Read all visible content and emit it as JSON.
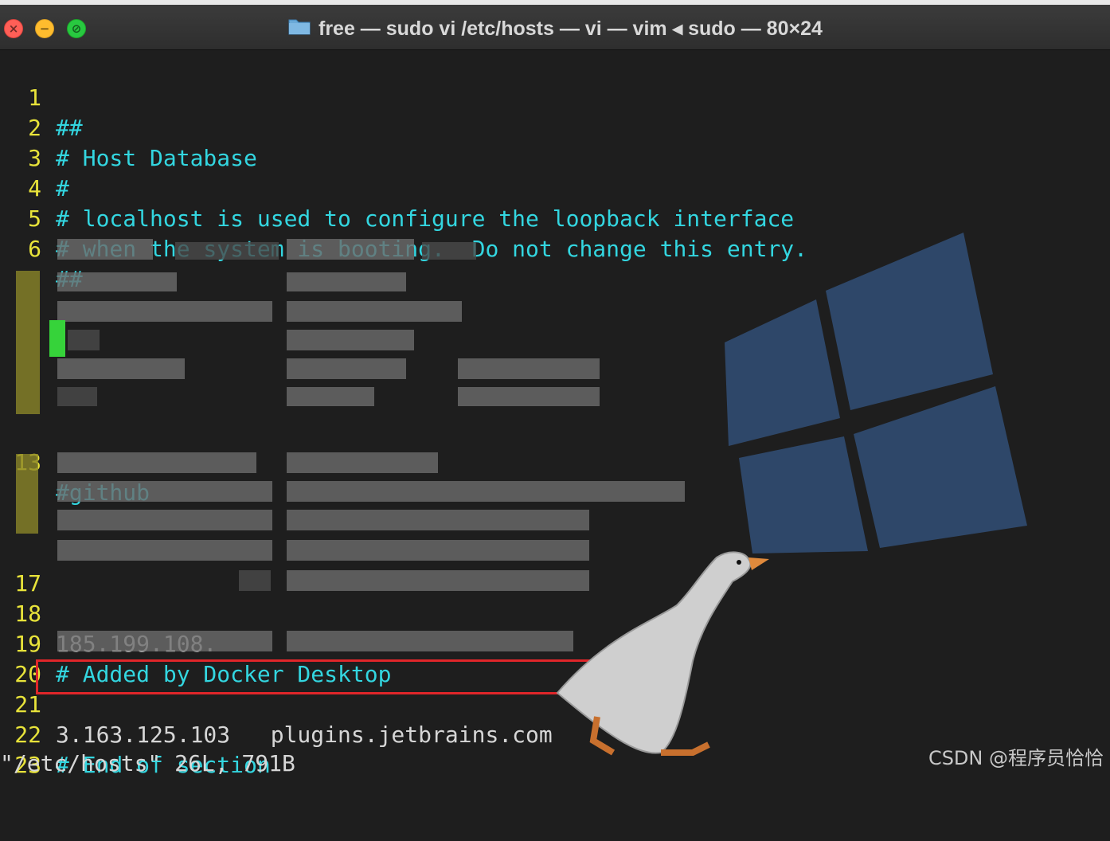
{
  "window": {
    "title": "free — sudo vi /etc/hosts — vi — vim ◂ sudo — 80×24",
    "controls": {
      "close_glyph": "×",
      "minimize_glyph": "−",
      "zoom_glyph": "⊘"
    }
  },
  "editor": {
    "lines": [
      {
        "num": "1",
        "text": "##",
        "color": "cyan"
      },
      {
        "num": "2",
        "text": "# Host Database",
        "color": "cyan"
      },
      {
        "num": "3",
        "text": "#",
        "color": "cyan"
      },
      {
        "num": "4",
        "text": "# localhost is used to configure the loopback interface",
        "color": "cyan"
      },
      {
        "num": "5",
        "text": "# when the system is booting.  Do not change this entry.",
        "color": "cyan"
      },
      {
        "num": "6",
        "text": "##",
        "color": "cyan"
      },
      {
        "num": "13",
        "text": "#github",
        "color": "cyan"
      },
      {
        "num": "17",
        "text": "",
        "color": "white"
      },
      {
        "num": "18",
        "text": "185.199.108.",
        "color": "white"
      },
      {
        "num": "19",
        "text": "# Added by Docker Desktop",
        "color": "cyan"
      },
      {
        "num": "20",
        "text": "",
        "color": "white"
      },
      {
        "num": "21",
        "text": "3.163.125.103   plugins.jetbrains.com",
        "color": "white"
      },
      {
        "num": "22",
        "text": "# End of section",
        "color": "cyan"
      },
      {
        "num": "23",
        "text": "",
        "color": "white"
      }
    ],
    "status_line": "\"/etc/hosts\" 26L, 791B"
  },
  "watermark": "CSDN @程序员恰恰",
  "colors": {
    "line_number": "#e8e33a",
    "comment": "#33d6e0",
    "text": "#d6d6d6",
    "highlight_box": "#e0262a",
    "windows_logo": "#2f4a6e"
  }
}
